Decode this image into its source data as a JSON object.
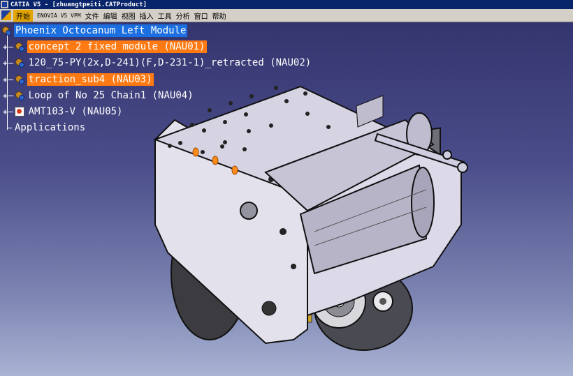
{
  "window": {
    "title": "CATIA V5 - [zhuangtpeiti.CATProduct]",
    "app_icon": "catia-app-icon"
  },
  "menubar": {
    "window_icon": "product-window-icon",
    "items": [
      "开始",
      "ENOVIA V5 VPM",
      "文件",
      "编辑",
      "视图",
      "插入",
      "工具",
      "分析",
      "窗口",
      "帮助"
    ],
    "active_item": "开始",
    "accent_color": "#e2a400"
  },
  "tree": {
    "root": {
      "label": "Phoenix Octocanum Left Module",
      "icon": "product-icon",
      "highlight_color": "#1b6fe0"
    },
    "children": [
      {
        "label": "concept 2 fixed module (NAU01)",
        "icon": "product-icon",
        "selected": true
      },
      {
        "label": "120_75-PY(2x,D-241)(F,D-231-1)_retracted (NAU02)",
        "icon": "product-icon",
        "selected": false
      },
      {
        "label": "traction_sub4 (NAU03)",
        "icon": "product-icon",
        "selected": true
      },
      {
        "label": "Loop of No 25 Chain1 (NAU04)",
        "icon": "product-icon",
        "selected": false
      },
      {
        "label": "AMT103-V (NAU05)",
        "icon": "part-icon",
        "selected": false
      }
    ],
    "applications_label": "Applications",
    "selection_color": "#ff7a12"
  },
  "viewport": {
    "background_top": "#34346e",
    "background_bottom": "#a9b3d3",
    "model": "3d-assembly-model"
  }
}
